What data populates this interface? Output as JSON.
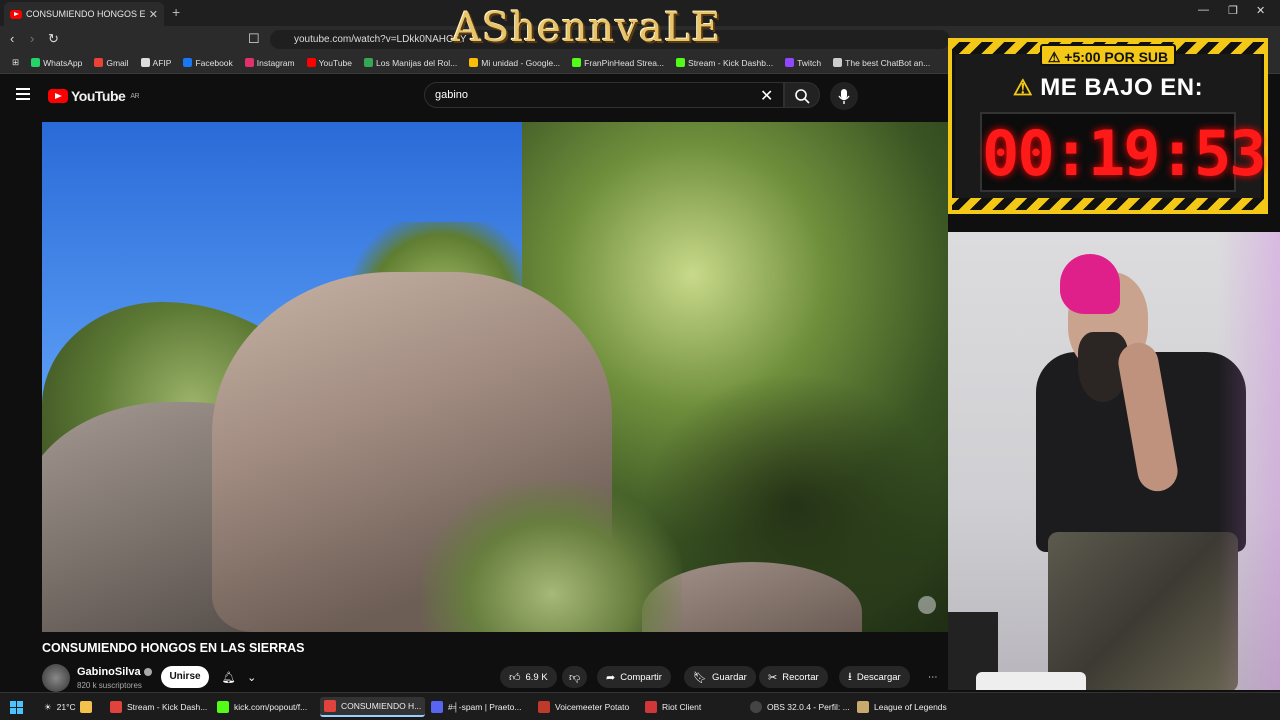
{
  "browser": {
    "tab_title": "CONSUMIENDO HONGOS EI",
    "url": "youtube.com/watch?v=LDkk0NAHCPY",
    "new_tab": "+",
    "close": "✕",
    "bookmarks": [
      {
        "label": "WhatsApp",
        "color": "#25d366"
      },
      {
        "label": "Gmail",
        "color": "#ea4335"
      },
      {
        "label": "AFIP",
        "color": "#dddddd"
      },
      {
        "label": "Facebook",
        "color": "#1877f2"
      },
      {
        "label": "Instagram",
        "color": "#e1306c"
      },
      {
        "label": "YouTube",
        "color": "#ff0000"
      },
      {
        "label": "Los Manijas del Rol...",
        "color": "#34a853"
      },
      {
        "label": "Mi unidad - Google...",
        "color": "#fbbc05"
      },
      {
        "label": "FranPinHead Strea...",
        "color": "#53fc18"
      },
      {
        "label": "Stream - Kick Dashb...",
        "color": "#53fc18"
      },
      {
        "label": "Twitch",
        "color": "#9146ff"
      },
      {
        "label": "The best ChatBot an...",
        "color": "#cccccc"
      }
    ]
  },
  "overlay_logo": "AShennvaLE",
  "youtube": {
    "logo_text": "YouTube",
    "region": "AR",
    "search_value": "gabino",
    "video_title": "CONSUMIENDO HONGOS EN LAS SIERRAS",
    "channel_name": "GabinoSilva",
    "subscribers": "820 k suscriptores",
    "join_label": "Unirse",
    "likes": "6.9 K",
    "share_label": "Compartir",
    "save_label": "Guardar",
    "clip_label": "Recortar",
    "download_label": "Descargar",
    "more_label": "⋯"
  },
  "stream": {
    "sub_bonus": "+5:00 POR SUB",
    "headline": "ME BAJO EN:",
    "timer": "00:19:53",
    "accent": "#f4c817",
    "timer_color": "#ff1a1a"
  },
  "taskbar": {
    "weather": "21°C",
    "items": [
      {
        "label": "Stream - Kick Dash...",
        "color": "#e0433c"
      },
      {
        "label": "kick.com/popout/f...",
        "color": "#53fc18"
      },
      {
        "label": "CONSUMIENDO H...",
        "color": "#e0433c"
      },
      {
        "label": "#╡-spam | Praeto...",
        "color": "#5865f2"
      },
      {
        "label": "Voicemeeter Potato",
        "color": "#c0392b"
      },
      {
        "label": "Riot Client",
        "color": "#d13639"
      },
      {
        "label": "OBS 32.0.4 - Perfil: ...",
        "color": "#444444"
      },
      {
        "label": "League of Legends",
        "color": "#c8aa6e"
      }
    ]
  }
}
